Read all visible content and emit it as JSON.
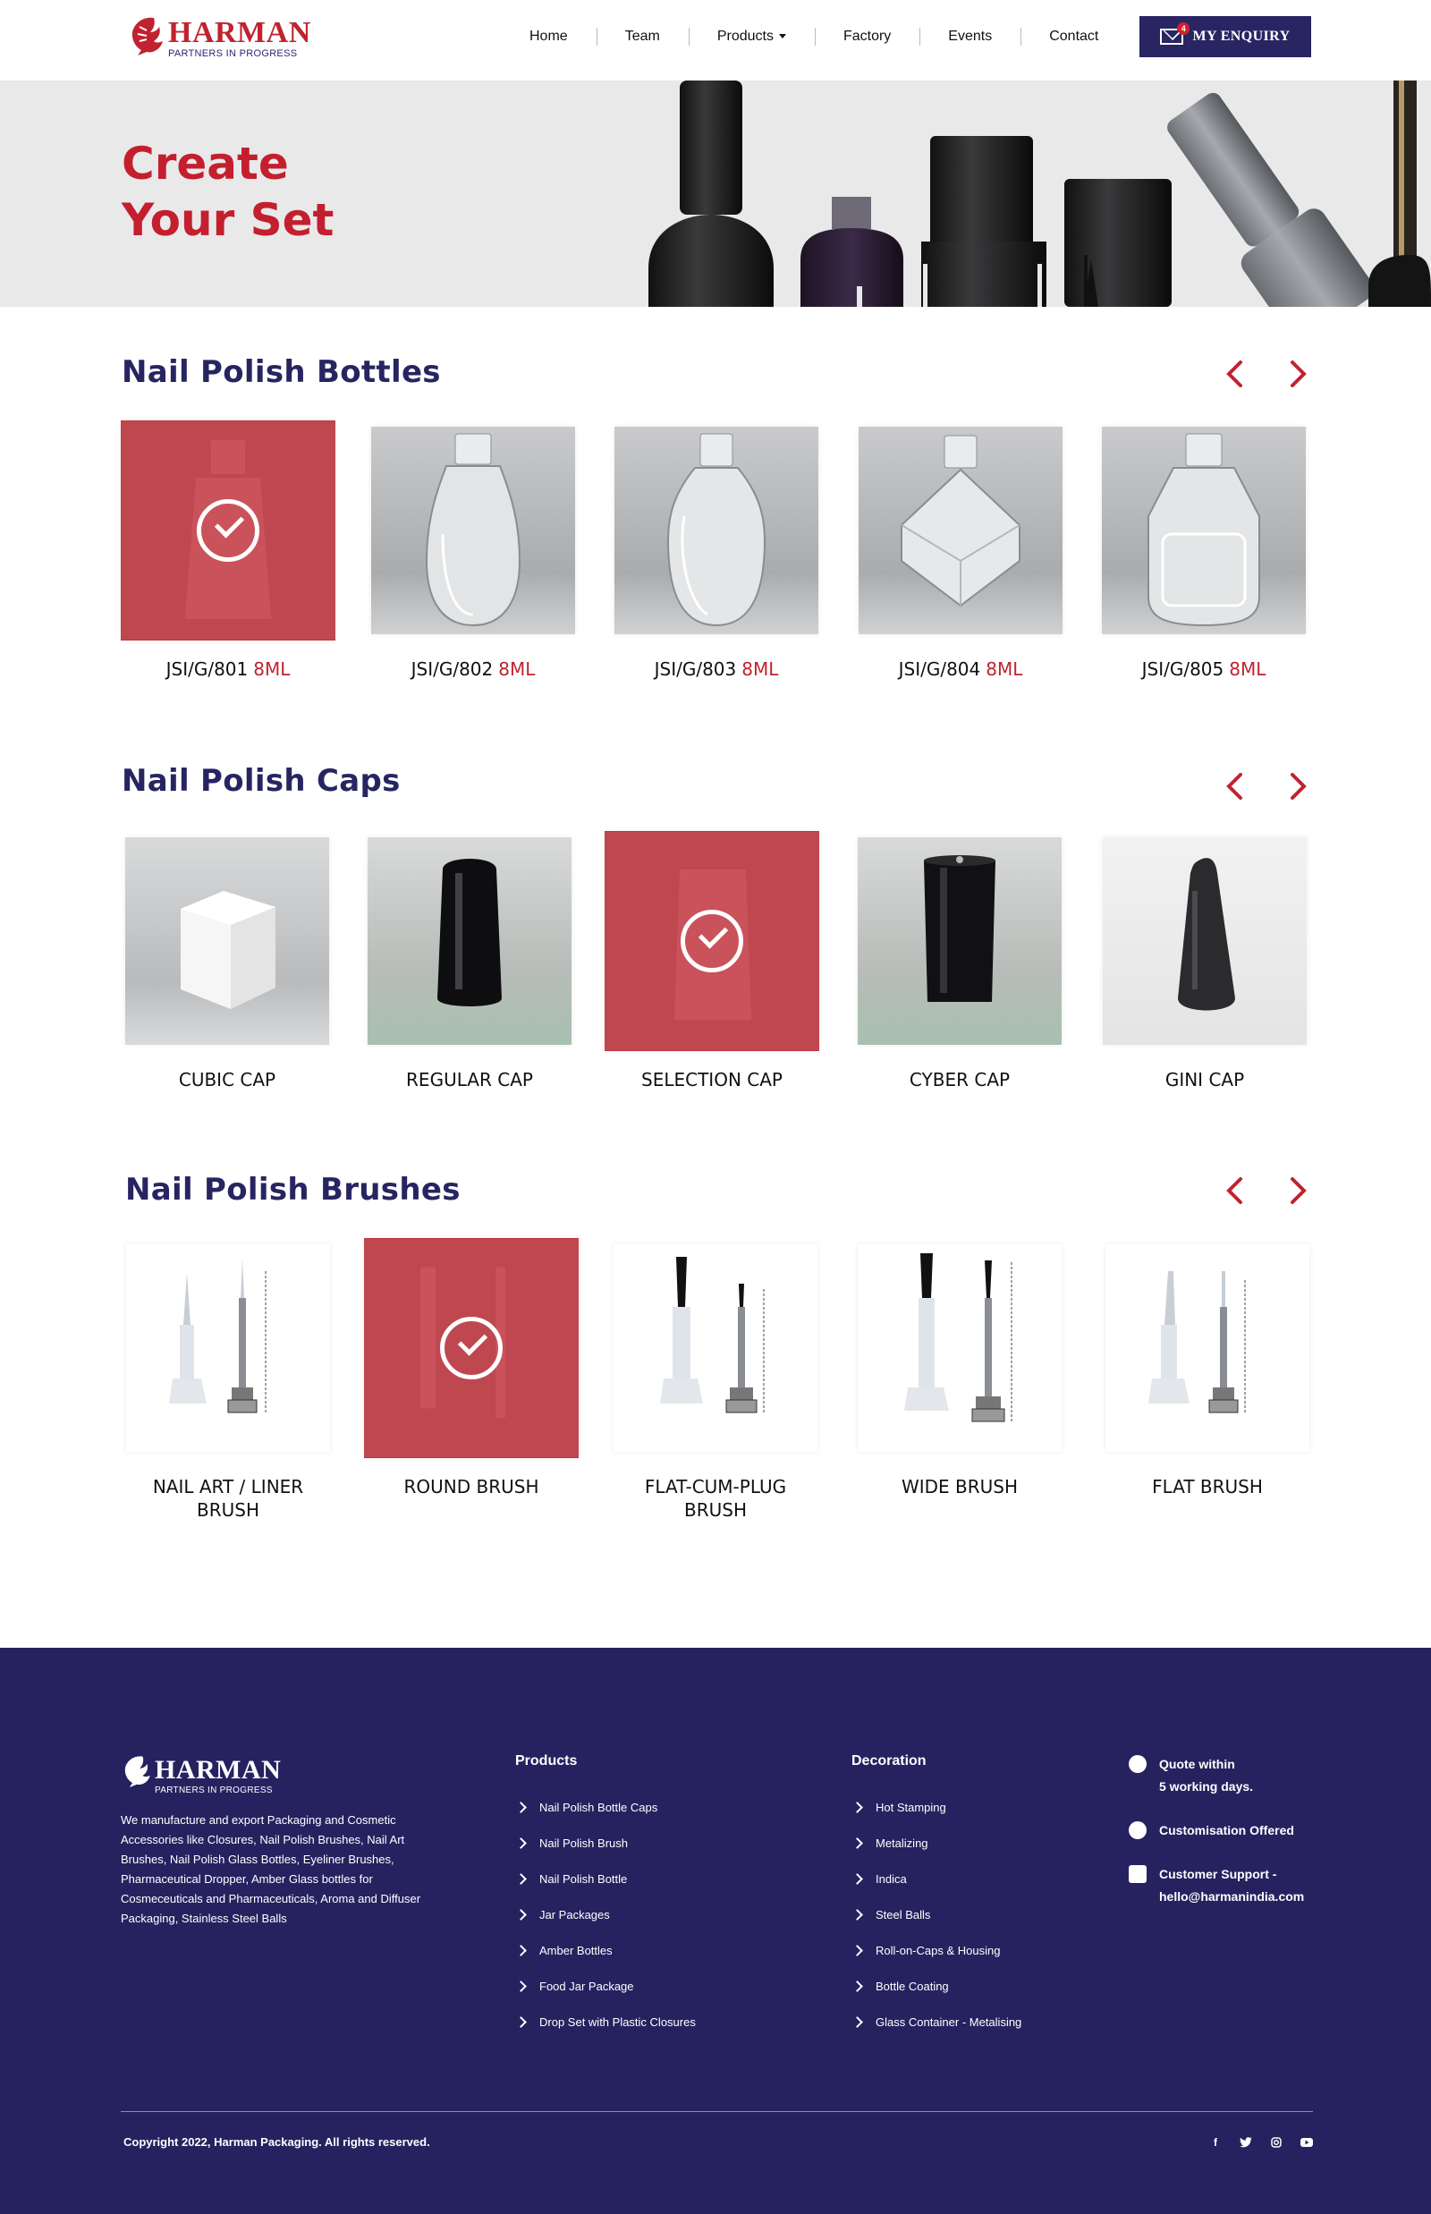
{
  "header": {
    "logo_name": "HARMAN",
    "logo_tagline": "PARTNERS IN PROGRESS",
    "nav": [
      {
        "label": "Home"
      },
      {
        "label": "Team"
      },
      {
        "label": "Products",
        "has_dropdown": true
      },
      {
        "label": "Factory"
      },
      {
        "label": "Events"
      },
      {
        "label": "Contact"
      }
    ],
    "enquiry_label": "MY ENQUIRY",
    "enquiry_count": "4"
  },
  "hero": {
    "title_line1": "Create",
    "title_line2": "Your Set"
  },
  "sections": [
    {
      "title": "Nail Polish Bottles",
      "items": [
        {
          "code": "JSI/G/801",
          "size": "8ML",
          "selected": true
        },
        {
          "code": "JSI/G/802",
          "size": "8ML",
          "selected": false
        },
        {
          "code": "JSI/G/803",
          "size": "8ML",
          "selected": false
        },
        {
          "code": "JSI/G/804",
          "size": "8ML",
          "selected": false
        },
        {
          "code": "JSI/G/805",
          "size": "8ML",
          "selected": false
        }
      ]
    },
    {
      "title": "Nail Polish Caps",
      "items": [
        {
          "name": "CUBIC CAP",
          "selected": false
        },
        {
          "name": "REGULAR CAP",
          "selected": false
        },
        {
          "name": "SELECTION CAP",
          "selected": true
        },
        {
          "name": "CYBER CAP",
          "selected": false
        },
        {
          "name": "GINI CAP",
          "selected": false
        }
      ]
    },
    {
      "title": "Nail Polish Brushes",
      "items": [
        {
          "name_line1": "NAIL ART / LINER",
          "name_line2": "BRUSH",
          "selected": false
        },
        {
          "name_line1": "ROUND BRUSH",
          "name_line2": "",
          "selected": true
        },
        {
          "name_line1": "FLAT-CUM-PLUG",
          "name_line2": "BRUSH",
          "selected": false
        },
        {
          "name_line1": "WIDE BRUSH",
          "name_line2": "",
          "selected": false
        },
        {
          "name_line1": "FLAT BRUSH",
          "name_line2": "",
          "selected": false
        }
      ]
    }
  ],
  "footer": {
    "logo_name": "HARMAN",
    "logo_tagline": "PARTNERS IN PROGRESS",
    "about": "We manufacture and export Packaging and Cosmetic Accessories like Closures, Nail Polish Brushes, Nail Art Brushes, Nail Polish Glass Bottles, Eyeliner Brushes, Pharmaceutical Dropper, Amber Glass bottles for Cosmeceuticals and Pharmaceuticals, Aroma and Diffuser Packaging, Stainless Steel Balls",
    "products_title": "Products",
    "products": [
      "Nail Polish Bottle Caps",
      "Nail Polish Brush",
      "Nail Polish Bottle",
      "Jar Packages",
      "Amber Bottles",
      "Food Jar Package",
      "Drop Set with Plastic Closures"
    ],
    "decoration_title": "Decoration",
    "decoration": [
      "Hot Stamping",
      "Metalizing",
      "Indica",
      "Steel Balls",
      "Roll-on-Caps & Housing",
      "Bottle Coating",
      "Glass Container - Metalising"
    ],
    "info": [
      {
        "icon": "rupee-icon",
        "line1": "Quote within",
        "line2": "5 working days."
      },
      {
        "icon": "lock-icon",
        "line1": "Customisation Offered",
        "line2": ""
      },
      {
        "icon": "chat-icon",
        "line1": "Customer Support -",
        "line2": "hello@harmanindia.com"
      }
    ],
    "copyright": "Copyright 2022, Harman Packaging. All rights reserved.",
    "social": [
      "facebook-icon",
      "twitter-icon",
      "instagram-icon",
      "youtube-icon"
    ]
  },
  "colors": {
    "brand_red": "#c0232f",
    "brand_navy": "#262260",
    "selected_overlay": "#c0313b"
  }
}
